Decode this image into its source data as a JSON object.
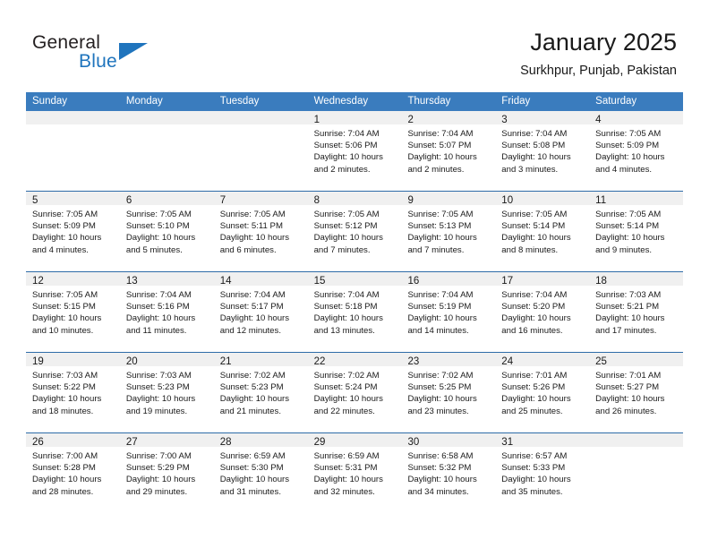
{
  "brand": {
    "name_part1": "General",
    "name_part2": "Blue",
    "triangle_icon": "triangle-logo-icon",
    "accent_color": "#1f74bd"
  },
  "header": {
    "title": "January 2025",
    "location": "Surkhpur, Punjab, Pakistan"
  },
  "theme": {
    "header_blue": "#3a7cbe",
    "divider_blue": "#2e6ca8",
    "day_band_gray": "#f0f0f0",
    "text_color": "#1a1a1a"
  },
  "day_names": [
    "Sunday",
    "Monday",
    "Tuesday",
    "Wednesday",
    "Thursday",
    "Friday",
    "Saturday"
  ],
  "weeks": [
    [
      {
        "empty": true,
        "day": "",
        "lines": []
      },
      {
        "empty": true,
        "day": "",
        "lines": []
      },
      {
        "empty": true,
        "day": "",
        "lines": []
      },
      {
        "empty": false,
        "day": "1",
        "lines": [
          "Sunrise: 7:04 AM",
          "Sunset: 5:06 PM",
          "Daylight: 10 hours",
          "and 2 minutes."
        ]
      },
      {
        "empty": false,
        "day": "2",
        "lines": [
          "Sunrise: 7:04 AM",
          "Sunset: 5:07 PM",
          "Daylight: 10 hours",
          "and 2 minutes."
        ]
      },
      {
        "empty": false,
        "day": "3",
        "lines": [
          "Sunrise: 7:04 AM",
          "Sunset: 5:08 PM",
          "Daylight: 10 hours",
          "and 3 minutes."
        ]
      },
      {
        "empty": false,
        "day": "4",
        "lines": [
          "Sunrise: 7:05 AM",
          "Sunset: 5:09 PM",
          "Daylight: 10 hours",
          "and 4 minutes."
        ]
      }
    ],
    [
      {
        "empty": false,
        "day": "5",
        "lines": [
          "Sunrise: 7:05 AM",
          "Sunset: 5:09 PM",
          "Daylight: 10 hours",
          "and 4 minutes."
        ]
      },
      {
        "empty": false,
        "day": "6",
        "lines": [
          "Sunrise: 7:05 AM",
          "Sunset: 5:10 PM",
          "Daylight: 10 hours",
          "and 5 minutes."
        ]
      },
      {
        "empty": false,
        "day": "7",
        "lines": [
          "Sunrise: 7:05 AM",
          "Sunset: 5:11 PM",
          "Daylight: 10 hours",
          "and 6 minutes."
        ]
      },
      {
        "empty": false,
        "day": "8",
        "lines": [
          "Sunrise: 7:05 AM",
          "Sunset: 5:12 PM",
          "Daylight: 10 hours",
          "and 7 minutes."
        ]
      },
      {
        "empty": false,
        "day": "9",
        "lines": [
          "Sunrise: 7:05 AM",
          "Sunset: 5:13 PM",
          "Daylight: 10 hours",
          "and 7 minutes."
        ]
      },
      {
        "empty": false,
        "day": "10",
        "lines": [
          "Sunrise: 7:05 AM",
          "Sunset: 5:14 PM",
          "Daylight: 10 hours",
          "and 8 minutes."
        ]
      },
      {
        "empty": false,
        "day": "11",
        "lines": [
          "Sunrise: 7:05 AM",
          "Sunset: 5:14 PM",
          "Daylight: 10 hours",
          "and 9 minutes."
        ]
      }
    ],
    [
      {
        "empty": false,
        "day": "12",
        "lines": [
          "Sunrise: 7:05 AM",
          "Sunset: 5:15 PM",
          "Daylight: 10 hours",
          "and 10 minutes."
        ]
      },
      {
        "empty": false,
        "day": "13",
        "lines": [
          "Sunrise: 7:04 AM",
          "Sunset: 5:16 PM",
          "Daylight: 10 hours",
          "and 11 minutes."
        ]
      },
      {
        "empty": false,
        "day": "14",
        "lines": [
          "Sunrise: 7:04 AM",
          "Sunset: 5:17 PM",
          "Daylight: 10 hours",
          "and 12 minutes."
        ]
      },
      {
        "empty": false,
        "day": "15",
        "lines": [
          "Sunrise: 7:04 AM",
          "Sunset: 5:18 PM",
          "Daylight: 10 hours",
          "and 13 minutes."
        ]
      },
      {
        "empty": false,
        "day": "16",
        "lines": [
          "Sunrise: 7:04 AM",
          "Sunset: 5:19 PM",
          "Daylight: 10 hours",
          "and 14 minutes."
        ]
      },
      {
        "empty": false,
        "day": "17",
        "lines": [
          "Sunrise: 7:04 AM",
          "Sunset: 5:20 PM",
          "Daylight: 10 hours",
          "and 16 minutes."
        ]
      },
      {
        "empty": false,
        "day": "18",
        "lines": [
          "Sunrise: 7:03 AM",
          "Sunset: 5:21 PM",
          "Daylight: 10 hours",
          "and 17 minutes."
        ]
      }
    ],
    [
      {
        "empty": false,
        "day": "19",
        "lines": [
          "Sunrise: 7:03 AM",
          "Sunset: 5:22 PM",
          "Daylight: 10 hours",
          "and 18 minutes."
        ]
      },
      {
        "empty": false,
        "day": "20",
        "lines": [
          "Sunrise: 7:03 AM",
          "Sunset: 5:23 PM",
          "Daylight: 10 hours",
          "and 19 minutes."
        ]
      },
      {
        "empty": false,
        "day": "21",
        "lines": [
          "Sunrise: 7:02 AM",
          "Sunset: 5:23 PM",
          "Daylight: 10 hours",
          "and 21 minutes."
        ]
      },
      {
        "empty": false,
        "day": "22",
        "lines": [
          "Sunrise: 7:02 AM",
          "Sunset: 5:24 PM",
          "Daylight: 10 hours",
          "and 22 minutes."
        ]
      },
      {
        "empty": false,
        "day": "23",
        "lines": [
          "Sunrise: 7:02 AM",
          "Sunset: 5:25 PM",
          "Daylight: 10 hours",
          "and 23 minutes."
        ]
      },
      {
        "empty": false,
        "day": "24",
        "lines": [
          "Sunrise: 7:01 AM",
          "Sunset: 5:26 PM",
          "Daylight: 10 hours",
          "and 25 minutes."
        ]
      },
      {
        "empty": false,
        "day": "25",
        "lines": [
          "Sunrise: 7:01 AM",
          "Sunset: 5:27 PM",
          "Daylight: 10 hours",
          "and 26 minutes."
        ]
      }
    ],
    [
      {
        "empty": false,
        "day": "26",
        "lines": [
          "Sunrise: 7:00 AM",
          "Sunset: 5:28 PM",
          "Daylight: 10 hours",
          "and 28 minutes."
        ]
      },
      {
        "empty": false,
        "day": "27",
        "lines": [
          "Sunrise: 7:00 AM",
          "Sunset: 5:29 PM",
          "Daylight: 10 hours",
          "and 29 minutes."
        ]
      },
      {
        "empty": false,
        "day": "28",
        "lines": [
          "Sunrise: 6:59 AM",
          "Sunset: 5:30 PM",
          "Daylight: 10 hours",
          "and 31 minutes."
        ]
      },
      {
        "empty": false,
        "day": "29",
        "lines": [
          "Sunrise: 6:59 AM",
          "Sunset: 5:31 PM",
          "Daylight: 10 hours",
          "and 32 minutes."
        ]
      },
      {
        "empty": false,
        "day": "30",
        "lines": [
          "Sunrise: 6:58 AM",
          "Sunset: 5:32 PM",
          "Daylight: 10 hours",
          "and 34 minutes."
        ]
      },
      {
        "empty": false,
        "day": "31",
        "lines": [
          "Sunrise: 6:57 AM",
          "Sunset: 5:33 PM",
          "Daylight: 10 hours",
          "and 35 minutes."
        ]
      },
      {
        "empty": true,
        "day": "",
        "lines": []
      }
    ]
  ]
}
